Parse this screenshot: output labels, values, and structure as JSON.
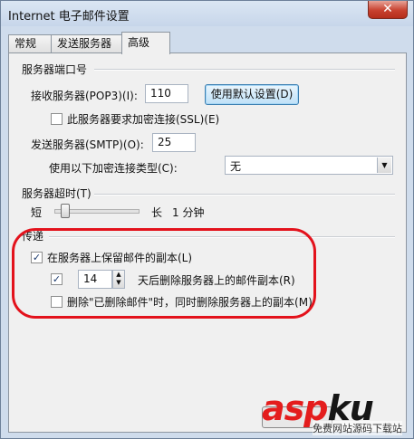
{
  "window": {
    "title": "Internet 电子邮件设置",
    "close_glyph": "✕"
  },
  "tabs": [
    {
      "label": "常规",
      "active": false
    },
    {
      "label": "发送服务器",
      "active": false
    },
    {
      "label": "高级",
      "active": true
    }
  ],
  "ports": {
    "group_label": "服务器端口号",
    "incoming_label": "接收服务器(POP3)(I):",
    "incoming_value": "110",
    "default_button": "使用默认设置(D)",
    "ssl_label": "此服务器要求加密连接(SSL)(E)",
    "ssl_checked": false,
    "outgoing_label": "发送服务器(SMTP)(O):",
    "outgoing_value": "25",
    "encryption_label": "使用以下加密连接类型(C):",
    "encryption_value": "无"
  },
  "timeout": {
    "group_label": "服务器超时(T)",
    "short_label": "短",
    "long_label": "长",
    "value_text": "1 分钟",
    "level": 0.08
  },
  "delivery": {
    "group_label": "传递",
    "keep_copy_label": "在服务器上保留邮件的副本(L)",
    "keep_copy_checked": true,
    "remove_after_checked": true,
    "remove_after_days": "14",
    "remove_after_label": "天后删除服务器上的邮件副本(R)",
    "remove_deleted_label": "删除\"已删除邮件\"时，同时删除服务器上的副本(M)",
    "remove_deleted_checked": false
  },
  "watermark": {
    "part1": "asp",
    "part2": "ku",
    "sub": "免费网站源码下载站"
  },
  "colors": {
    "highlight_loop": "#e3121c",
    "watermark_red": "#e41d1d"
  }
}
